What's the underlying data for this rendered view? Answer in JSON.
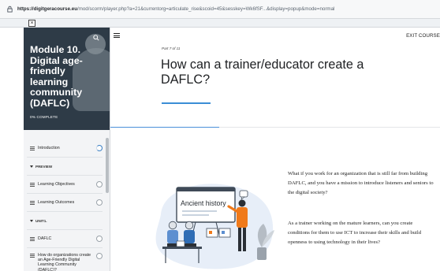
{
  "browser": {
    "url_host": "https://digitgeracourse.eu",
    "url_rest": "/mod/scorm/player.php?a=21&currentorg=articulate_rise&scoid=45&sesskey=Wk6fSF...&display=popup&mode=normal"
  },
  "popup": {
    "close_label": "×"
  },
  "sidebar": {
    "title": "Module 10. Digital age-friendly learning community (DAFLC)",
    "progress": "0% COMPLETE",
    "items": [
      {
        "label": "Introduction"
      },
      {
        "label": "PREVIEW"
      },
      {
        "label": "Learning Objectives"
      },
      {
        "label": "Learning Outcomes"
      },
      {
        "label": "UNIT1."
      },
      {
        "label": "DAFLC"
      },
      {
        "label": "How do organizations create an Age-Friendly Digital Learning Community (DAFLC)?"
      }
    ]
  },
  "main": {
    "exit_label": "EXIT COURSE",
    "part": "Part 7 of 11",
    "heading": "How can a trainer/educator create a DAFLC?",
    "paragraph1": "What if you work for an organization that is still far from building DAFLC, and you have a mission to introduce listeners and seniors to the digital society?",
    "paragraph2": "As a trainer working on the mature learners, can you create conditions for them to use ICT to increase their skills and build openness to using technology in their lives?",
    "image_board_text": "Ancient history"
  },
  "colors": {
    "accent": "#3b8ed6",
    "sidebar_hero": "#2e3b47",
    "illustration_figure": "#f07a1a"
  }
}
